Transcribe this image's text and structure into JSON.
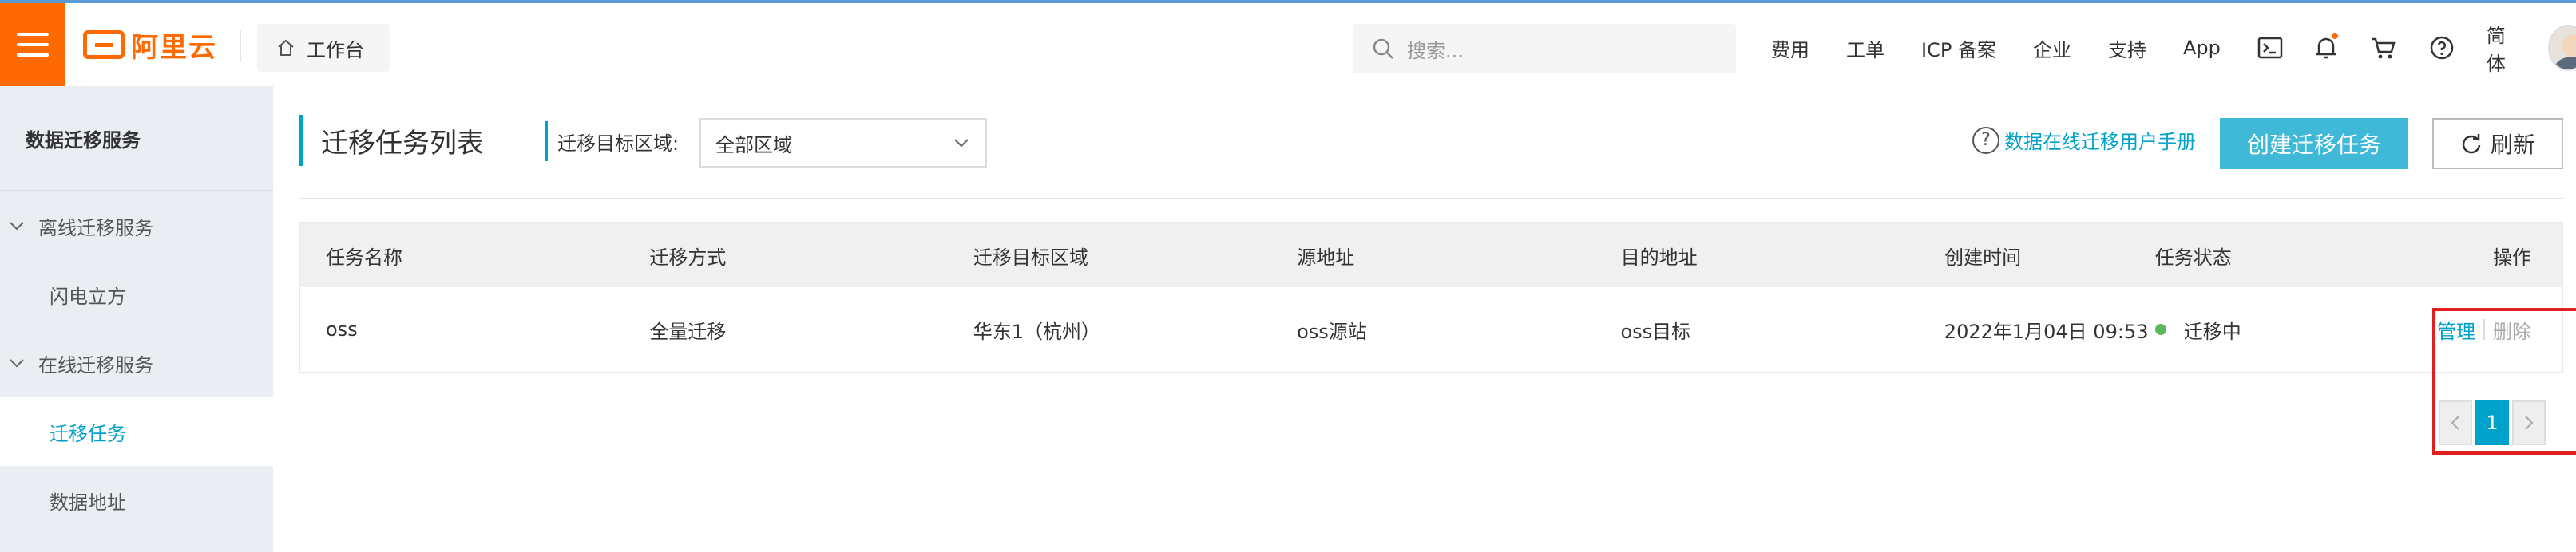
{
  "header": {
    "logo_text": "阿里云",
    "workbench_label": "工作台",
    "search_placeholder": "搜索...",
    "nav": [
      "费用",
      "工单",
      "ICP 备案",
      "企业",
      "支持",
      "App"
    ],
    "language": "简体",
    "icons": [
      "terminal-icon",
      "bell-icon",
      "cart-icon",
      "help-icon"
    ]
  },
  "sidebar": {
    "title": "数据迁移服务",
    "groups": [
      {
        "label": "离线迁移服务",
        "items": [
          "闪电立方"
        ]
      },
      {
        "label": "在线迁移服务",
        "items": [
          "迁移任务",
          "数据地址"
        ]
      }
    ],
    "active_item": "迁移任务"
  },
  "main": {
    "title": "迁移任务列表",
    "region_label": "迁移目标区域:",
    "region_value": "全部区域",
    "help_link": "数据在线迁移用户手册",
    "create_button": "创建迁移任务",
    "refresh_button": "刷新",
    "table": {
      "columns": [
        "任务名称",
        "迁移方式",
        "迁移目标区域",
        "源地址",
        "目的地址",
        "创建时间",
        "任务状态",
        "操作"
      ],
      "rows": [
        {
          "name": "oss",
          "method": "全量迁移",
          "region": "华东1（杭州）",
          "source": "oss源站",
          "destination": "oss目标",
          "created": "2022年1月04日 09:53",
          "status": "迁移中",
          "op_manage": "管理",
          "op_delete": "删除"
        }
      ]
    },
    "pagination": {
      "current": "1"
    }
  },
  "colors": {
    "brand": "#ff6a00",
    "accent": "#00a2ca",
    "status_running": "#5cb85c",
    "highlight": "#e02020"
  }
}
